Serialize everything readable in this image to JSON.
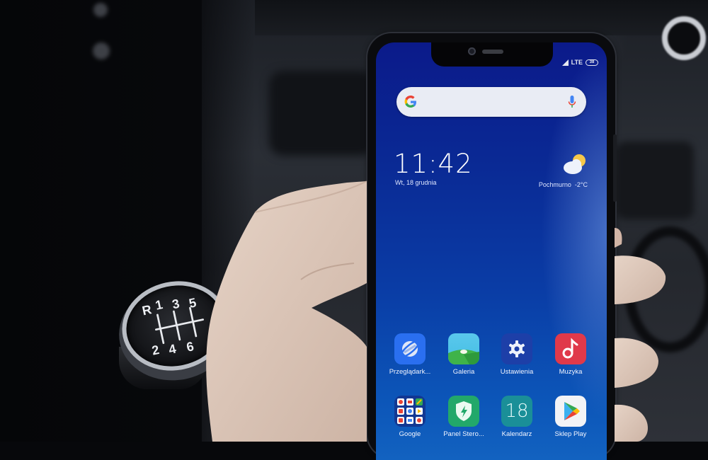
{
  "scene": {
    "description": "Hand holding a smartphone inside a car; gear shifter with pattern R 1 3 5 / 2 4 6 visible",
    "shifter_pattern": {
      "top_row": [
        "R",
        "1",
        "3",
        "5"
      ],
      "bottom_row": [
        "2",
        "4",
        "6"
      ]
    }
  },
  "phone": {
    "status_bar": {
      "network": "LTE",
      "battery_label": "38"
    },
    "search": {
      "provider_letter": "G",
      "placeholder": ""
    },
    "clock_widget": {
      "time": "11:42",
      "date": "Wt, 18 grudnia"
    },
    "weather_widget": {
      "condition": "Pochmurno",
      "temperature": "-2°C",
      "icon": "partly-cloudy-icon"
    },
    "apps": [
      {
        "label": "Przeglądark...",
        "icon": "browser-icon",
        "color": "#2a6ff0"
      },
      {
        "label": "Galeria",
        "icon": "gallery-icon",
        "color": "#4fc3e8"
      },
      {
        "label": "Ustawienia",
        "icon": "settings-gear-icon",
        "color": "#1d3fa8"
      },
      {
        "label": "Muzyka",
        "icon": "music-note-icon",
        "color": "#e0394a"
      },
      {
        "label": "Google",
        "icon": "google-folder-icon",
        "color": "#1a3b9e"
      },
      {
        "label": "Panel Stero...",
        "icon": "security-shield-icon",
        "color": "#22a86a"
      },
      {
        "label": "Kalendarz",
        "icon": "calendar-icon",
        "color": "#1a8f98",
        "day": "18"
      },
      {
        "label": "Sklep Play",
        "icon": "play-store-icon",
        "color": "#f2f3f6"
      }
    ]
  }
}
